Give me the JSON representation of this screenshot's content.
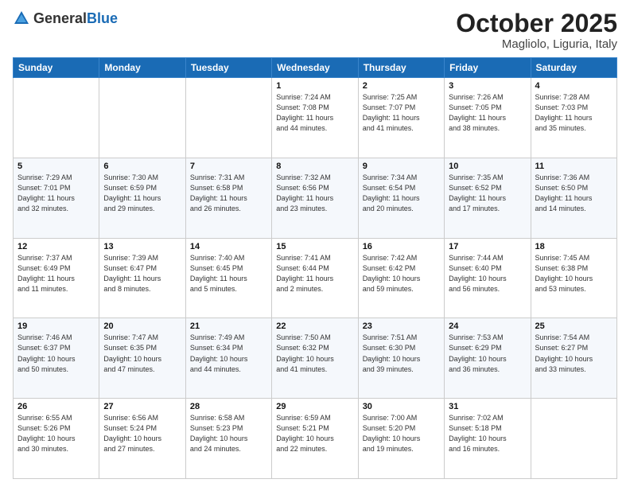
{
  "header": {
    "logo_general": "General",
    "logo_blue": "Blue",
    "month": "October 2025",
    "location": "Magliolo, Liguria, Italy"
  },
  "days_of_week": [
    "Sunday",
    "Monday",
    "Tuesday",
    "Wednesday",
    "Thursday",
    "Friday",
    "Saturday"
  ],
  "weeks": [
    [
      {
        "day": "",
        "info": ""
      },
      {
        "day": "",
        "info": ""
      },
      {
        "day": "",
        "info": ""
      },
      {
        "day": "1",
        "info": "Sunrise: 7:24 AM\nSunset: 7:08 PM\nDaylight: 11 hours\nand 44 minutes."
      },
      {
        "day": "2",
        "info": "Sunrise: 7:25 AM\nSunset: 7:07 PM\nDaylight: 11 hours\nand 41 minutes."
      },
      {
        "day": "3",
        "info": "Sunrise: 7:26 AM\nSunset: 7:05 PM\nDaylight: 11 hours\nand 38 minutes."
      },
      {
        "day": "4",
        "info": "Sunrise: 7:28 AM\nSunset: 7:03 PM\nDaylight: 11 hours\nand 35 minutes."
      }
    ],
    [
      {
        "day": "5",
        "info": "Sunrise: 7:29 AM\nSunset: 7:01 PM\nDaylight: 11 hours\nand 32 minutes."
      },
      {
        "day": "6",
        "info": "Sunrise: 7:30 AM\nSunset: 6:59 PM\nDaylight: 11 hours\nand 29 minutes."
      },
      {
        "day": "7",
        "info": "Sunrise: 7:31 AM\nSunset: 6:58 PM\nDaylight: 11 hours\nand 26 minutes."
      },
      {
        "day": "8",
        "info": "Sunrise: 7:32 AM\nSunset: 6:56 PM\nDaylight: 11 hours\nand 23 minutes."
      },
      {
        "day": "9",
        "info": "Sunrise: 7:34 AM\nSunset: 6:54 PM\nDaylight: 11 hours\nand 20 minutes."
      },
      {
        "day": "10",
        "info": "Sunrise: 7:35 AM\nSunset: 6:52 PM\nDaylight: 11 hours\nand 17 minutes."
      },
      {
        "day": "11",
        "info": "Sunrise: 7:36 AM\nSunset: 6:50 PM\nDaylight: 11 hours\nand 14 minutes."
      }
    ],
    [
      {
        "day": "12",
        "info": "Sunrise: 7:37 AM\nSunset: 6:49 PM\nDaylight: 11 hours\nand 11 minutes."
      },
      {
        "day": "13",
        "info": "Sunrise: 7:39 AM\nSunset: 6:47 PM\nDaylight: 11 hours\nand 8 minutes."
      },
      {
        "day": "14",
        "info": "Sunrise: 7:40 AM\nSunset: 6:45 PM\nDaylight: 11 hours\nand 5 minutes."
      },
      {
        "day": "15",
        "info": "Sunrise: 7:41 AM\nSunset: 6:44 PM\nDaylight: 11 hours\nand 2 minutes."
      },
      {
        "day": "16",
        "info": "Sunrise: 7:42 AM\nSunset: 6:42 PM\nDaylight: 10 hours\nand 59 minutes."
      },
      {
        "day": "17",
        "info": "Sunrise: 7:44 AM\nSunset: 6:40 PM\nDaylight: 10 hours\nand 56 minutes."
      },
      {
        "day": "18",
        "info": "Sunrise: 7:45 AM\nSunset: 6:38 PM\nDaylight: 10 hours\nand 53 minutes."
      }
    ],
    [
      {
        "day": "19",
        "info": "Sunrise: 7:46 AM\nSunset: 6:37 PM\nDaylight: 10 hours\nand 50 minutes."
      },
      {
        "day": "20",
        "info": "Sunrise: 7:47 AM\nSunset: 6:35 PM\nDaylight: 10 hours\nand 47 minutes."
      },
      {
        "day": "21",
        "info": "Sunrise: 7:49 AM\nSunset: 6:34 PM\nDaylight: 10 hours\nand 44 minutes."
      },
      {
        "day": "22",
        "info": "Sunrise: 7:50 AM\nSunset: 6:32 PM\nDaylight: 10 hours\nand 41 minutes."
      },
      {
        "day": "23",
        "info": "Sunrise: 7:51 AM\nSunset: 6:30 PM\nDaylight: 10 hours\nand 39 minutes."
      },
      {
        "day": "24",
        "info": "Sunrise: 7:53 AM\nSunset: 6:29 PM\nDaylight: 10 hours\nand 36 minutes."
      },
      {
        "day": "25",
        "info": "Sunrise: 7:54 AM\nSunset: 6:27 PM\nDaylight: 10 hours\nand 33 minutes."
      }
    ],
    [
      {
        "day": "26",
        "info": "Sunrise: 6:55 AM\nSunset: 5:26 PM\nDaylight: 10 hours\nand 30 minutes."
      },
      {
        "day": "27",
        "info": "Sunrise: 6:56 AM\nSunset: 5:24 PM\nDaylight: 10 hours\nand 27 minutes."
      },
      {
        "day": "28",
        "info": "Sunrise: 6:58 AM\nSunset: 5:23 PM\nDaylight: 10 hours\nand 24 minutes."
      },
      {
        "day": "29",
        "info": "Sunrise: 6:59 AM\nSunset: 5:21 PM\nDaylight: 10 hours\nand 22 minutes."
      },
      {
        "day": "30",
        "info": "Sunrise: 7:00 AM\nSunset: 5:20 PM\nDaylight: 10 hours\nand 19 minutes."
      },
      {
        "day": "31",
        "info": "Sunrise: 7:02 AM\nSunset: 5:18 PM\nDaylight: 10 hours\nand 16 minutes."
      },
      {
        "day": "",
        "info": ""
      }
    ]
  ]
}
